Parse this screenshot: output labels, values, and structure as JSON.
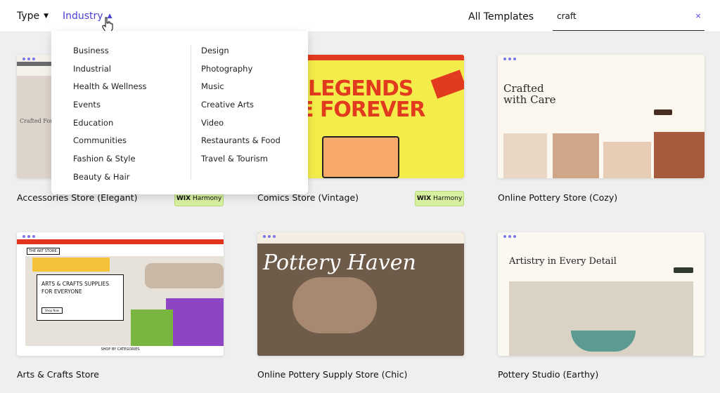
{
  "topbar": {
    "type_label": "Type",
    "industry_label": "Industry",
    "all_templates": "All Templates",
    "search_value": "craft",
    "clear_icon": "×"
  },
  "dropdown": {
    "left": [
      "Business",
      "Industrial",
      "Health & Wellness",
      "Events",
      "Education",
      "Communities",
      "Fashion & Style",
      "Beauty & Hair"
    ],
    "right": [
      "Design",
      "Photography",
      "Music",
      "Creative Arts",
      "Video",
      "Restaurants & Food",
      "Travel & Tourism"
    ]
  },
  "badge": {
    "wix": "WIX",
    "harmony": "Harmony"
  },
  "cards": [
    {
      "name": "Accessories Store (Elegant)",
      "badge": true,
      "thumb_text": "Crafted For D"
    },
    {
      "name": "Comics Store (Vintage)",
      "badge": true,
      "thumb_line1": "LEGENDS",
      "thumb_line2": "E FOREVER"
    },
    {
      "name": "Online Pottery Store (Cozy)",
      "badge": false,
      "thumb_line1": "Crafted",
      "thumb_line2": "with Care"
    },
    {
      "name": "Arts & Crafts Store",
      "badge": false,
      "thumb_line1": "ARTS & CRAFTS SUPPLIES",
      "thumb_line2": "FOR EVERYONE",
      "logo": "THE ART STORE.",
      "cta": "Shop Now",
      "footer": "SHOP BY CATEGORIES"
    },
    {
      "name": "Online Pottery Supply Store (Chic)",
      "badge": false,
      "thumb_text": "Pottery Haven"
    },
    {
      "name": "Pottery Studio (Earthy)",
      "badge": false,
      "thumb_text": "Artistry in Every Detail"
    }
  ],
  "colors": {
    "accent": "#4a3fd8",
    "badge_bg": "#d7f0a0",
    "comics_yellow": "#f3ec4a",
    "comics_red": "#e23a1e",
    "arts_red": "#e0341c"
  }
}
